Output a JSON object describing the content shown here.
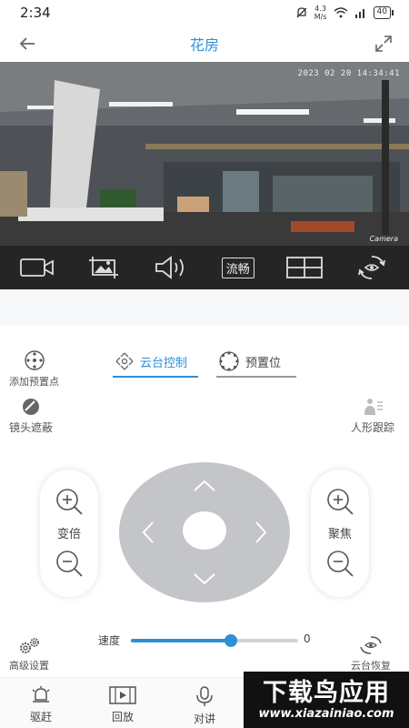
{
  "status_bar": {
    "time": "2:34",
    "net_speed_value": "4.3",
    "net_speed_unit": "M/s",
    "battery": "40"
  },
  "header": {
    "title": "花房"
  },
  "video": {
    "timestamp": "2023 02 20   14:34:41",
    "camera_label": "Camera"
  },
  "toolbar": {
    "fluency_label": "流畅"
  },
  "actions": {
    "add_preset": "添加预置点",
    "lens_mask": "镜头遮蔽",
    "human_tracking": "人形跟踪",
    "advanced": "高级设置",
    "ptz_restore": "云台恢复"
  },
  "tabs": [
    {
      "label": "云台控制",
      "active": true
    },
    {
      "label": "预置位",
      "active": false
    }
  ],
  "controls": {
    "zoom_label": "变倍",
    "focus_label": "聚焦"
  },
  "speed": {
    "label": "速度",
    "value": "0",
    "level": 0.6
  },
  "bottom_nav": [
    {
      "label": "驱赶",
      "icon": "bell-icon"
    },
    {
      "label": "回放",
      "icon": "film-icon"
    },
    {
      "label": "对讲",
      "icon": "mic-icon"
    }
  ],
  "watermark": {
    "title": "下载鸟应用",
    "url": "www.xiazainiao.com"
  },
  "colors": {
    "accent": "#2f8fd6",
    "toolbar_bg": "#252525",
    "dpad": "#c3c5c8"
  }
}
